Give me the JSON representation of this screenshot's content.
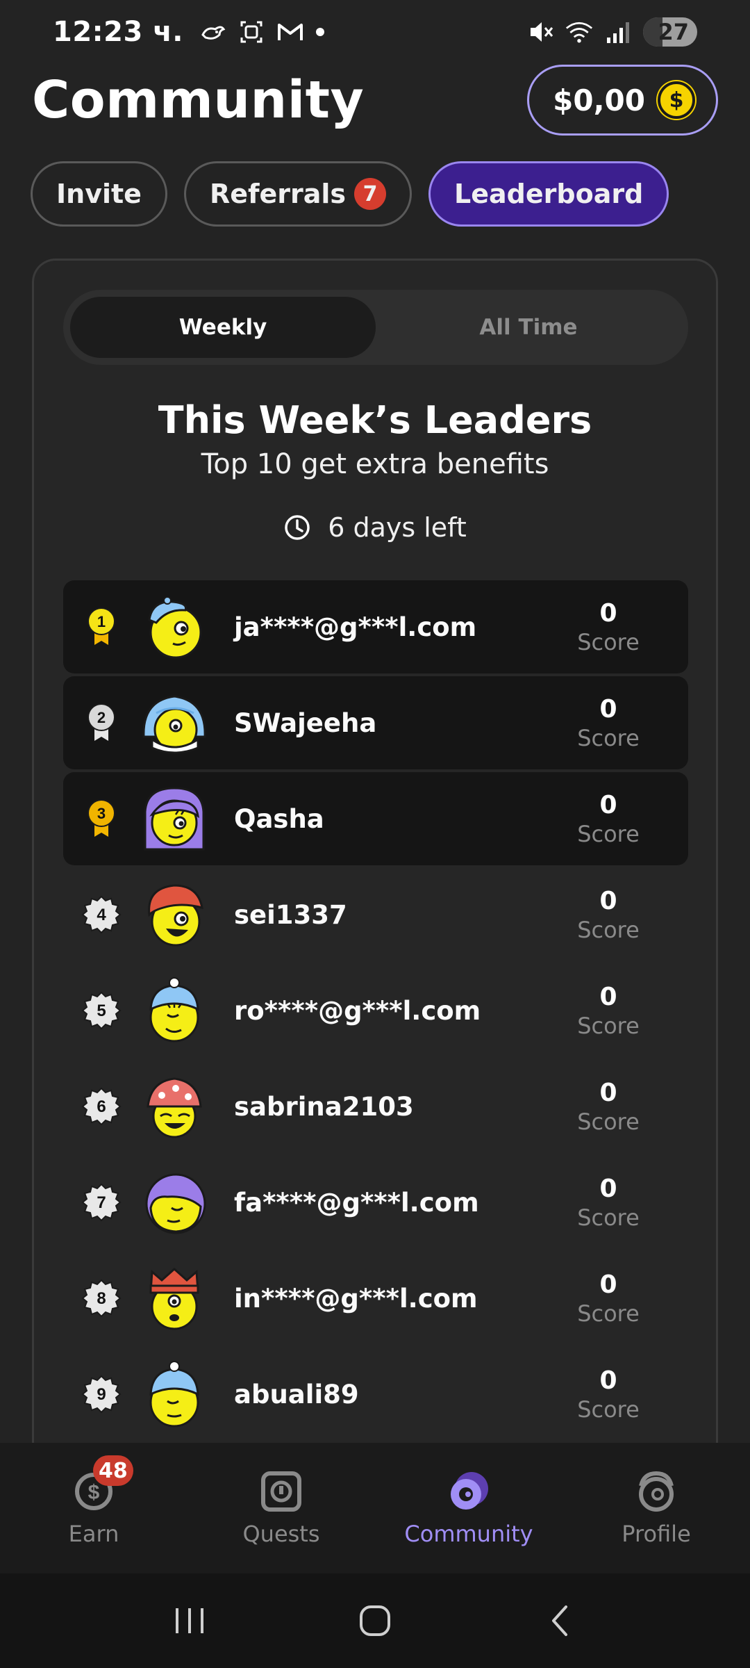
{
  "status_bar": {
    "time": "12:23 ч.",
    "battery": "27"
  },
  "header": {
    "title": "Community",
    "balance": "$0,00",
    "coin_symbol": "$"
  },
  "tabs": [
    {
      "label": "Invite",
      "active": false
    },
    {
      "label": "Referrals",
      "badge": "7",
      "active": false
    },
    {
      "label": "Leaderboard",
      "active": true
    }
  ],
  "period_toggle": {
    "weekly": "Weekly",
    "all_time": "All Time",
    "selected": "Weekly"
  },
  "leaders": {
    "title": "This Week’s Leaders",
    "subtitle": "Top 10 get extra benefits",
    "time_left": "6 days left",
    "score_label": "Score"
  },
  "leaderboard": [
    {
      "rank": "1",
      "name": "ja****@g***l.com",
      "score": "0",
      "avatar": "blue-cap-smirk"
    },
    {
      "rank": "2",
      "name": "SWajeeha",
      "score": "0",
      "avatar": "blue-hijab"
    },
    {
      "rank": "3",
      "name": "Qasha",
      "score": "0",
      "avatar": "purple-hair-wink"
    },
    {
      "rank": "4",
      "name": "sei1337",
      "score": "0",
      "avatar": "red-cap-laugh"
    },
    {
      "rank": "5",
      "name": "ro****@g***l.com",
      "score": "0",
      "avatar": "blue-beanie-wink"
    },
    {
      "rank": "6",
      "name": "sabrina2103",
      "score": "0",
      "avatar": "mushroom-hat"
    },
    {
      "rank": "7",
      "name": "fa****@g***l.com",
      "score": "0",
      "avatar": "purple-hair-sleepy"
    },
    {
      "rank": "8",
      "name": "in****@g***l.com",
      "score": "0",
      "avatar": "crown"
    },
    {
      "rank": "9",
      "name": "abuali89",
      "score": "0",
      "avatar": "blue-beanie-sleepy"
    }
  ],
  "bottom_nav": [
    {
      "label": "Earn",
      "badge": "48",
      "icon": "dollar-coin-icon",
      "active": false
    },
    {
      "label": "Quests",
      "icon": "quest-box-icon",
      "active": false
    },
    {
      "label": "Community",
      "icon": "community-icon",
      "active": true
    },
    {
      "label": "Profile",
      "icon": "profile-icon",
      "active": false
    }
  ],
  "colors": {
    "background": "#232323",
    "accent": "#a08ef5",
    "active_tab": "#3c1f8f",
    "badge": "#d63d2e",
    "gold": "#f3b600",
    "avatar_yellow": "#f5ee16"
  }
}
